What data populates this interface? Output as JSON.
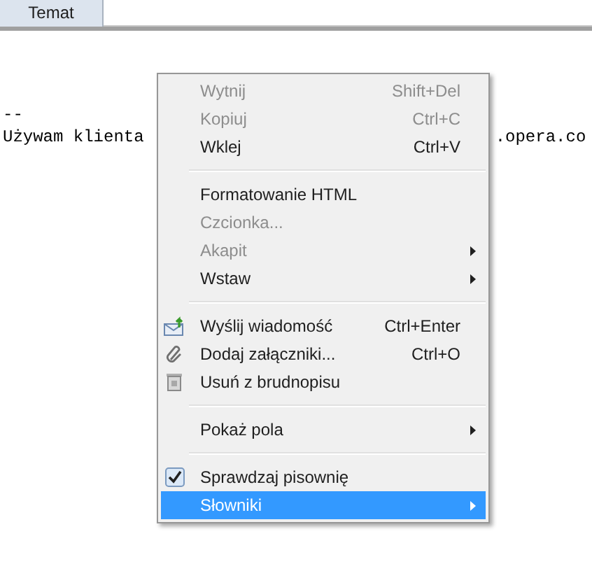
{
  "header": {
    "tab": "Temat"
  },
  "body": {
    "separator_line": "--",
    "signature_start": "Używam klienta",
    "signature_end": ".opera.co"
  },
  "context_menu": {
    "items": [
      {
        "kind": "item",
        "label": "Wytnij",
        "shortcut": "Shift+Del",
        "disabled": true,
        "selected": false,
        "submenu": false
      },
      {
        "kind": "item",
        "label": "Kopiuj",
        "shortcut": "Ctrl+C",
        "disabled": true,
        "selected": false,
        "submenu": false
      },
      {
        "kind": "item",
        "label": "Wklej",
        "shortcut": "Ctrl+V",
        "disabled": false,
        "selected": false,
        "submenu": false
      },
      {
        "kind": "separator"
      },
      {
        "kind": "item",
        "label": "Formatowanie HTML",
        "disabled": false,
        "selected": false,
        "submenu": false
      },
      {
        "kind": "item",
        "label": "Czcionka...",
        "disabled": true,
        "selected": false,
        "submenu": false
      },
      {
        "kind": "item",
        "label": "Akapit",
        "disabled": true,
        "selected": false,
        "submenu": true
      },
      {
        "kind": "item",
        "label": "Wstaw",
        "disabled": false,
        "selected": false,
        "submenu": true
      },
      {
        "kind": "separator"
      },
      {
        "kind": "item",
        "label": "Wyślij wiadomość",
        "shortcut": "Ctrl+Enter",
        "disabled": false,
        "selected": false,
        "submenu": false
      },
      {
        "kind": "item",
        "label": "Dodaj załączniki...",
        "shortcut": "Ctrl+O",
        "disabled": false,
        "selected": false,
        "submenu": false
      },
      {
        "kind": "item",
        "label": "Usuń z brudnopisu",
        "disabled": false,
        "selected": false,
        "submenu": false
      },
      {
        "kind": "separator"
      },
      {
        "kind": "item",
        "label": "Pokaż pola",
        "disabled": false,
        "selected": false,
        "submenu": true
      },
      {
        "kind": "separator"
      },
      {
        "kind": "item",
        "label": "Sprawdzaj pisownię",
        "disabled": false,
        "selected": false,
        "submenu": false,
        "checked": true
      },
      {
        "kind": "item",
        "label": "Słowniki",
        "disabled": false,
        "selected": true,
        "submenu": true
      }
    ]
  }
}
